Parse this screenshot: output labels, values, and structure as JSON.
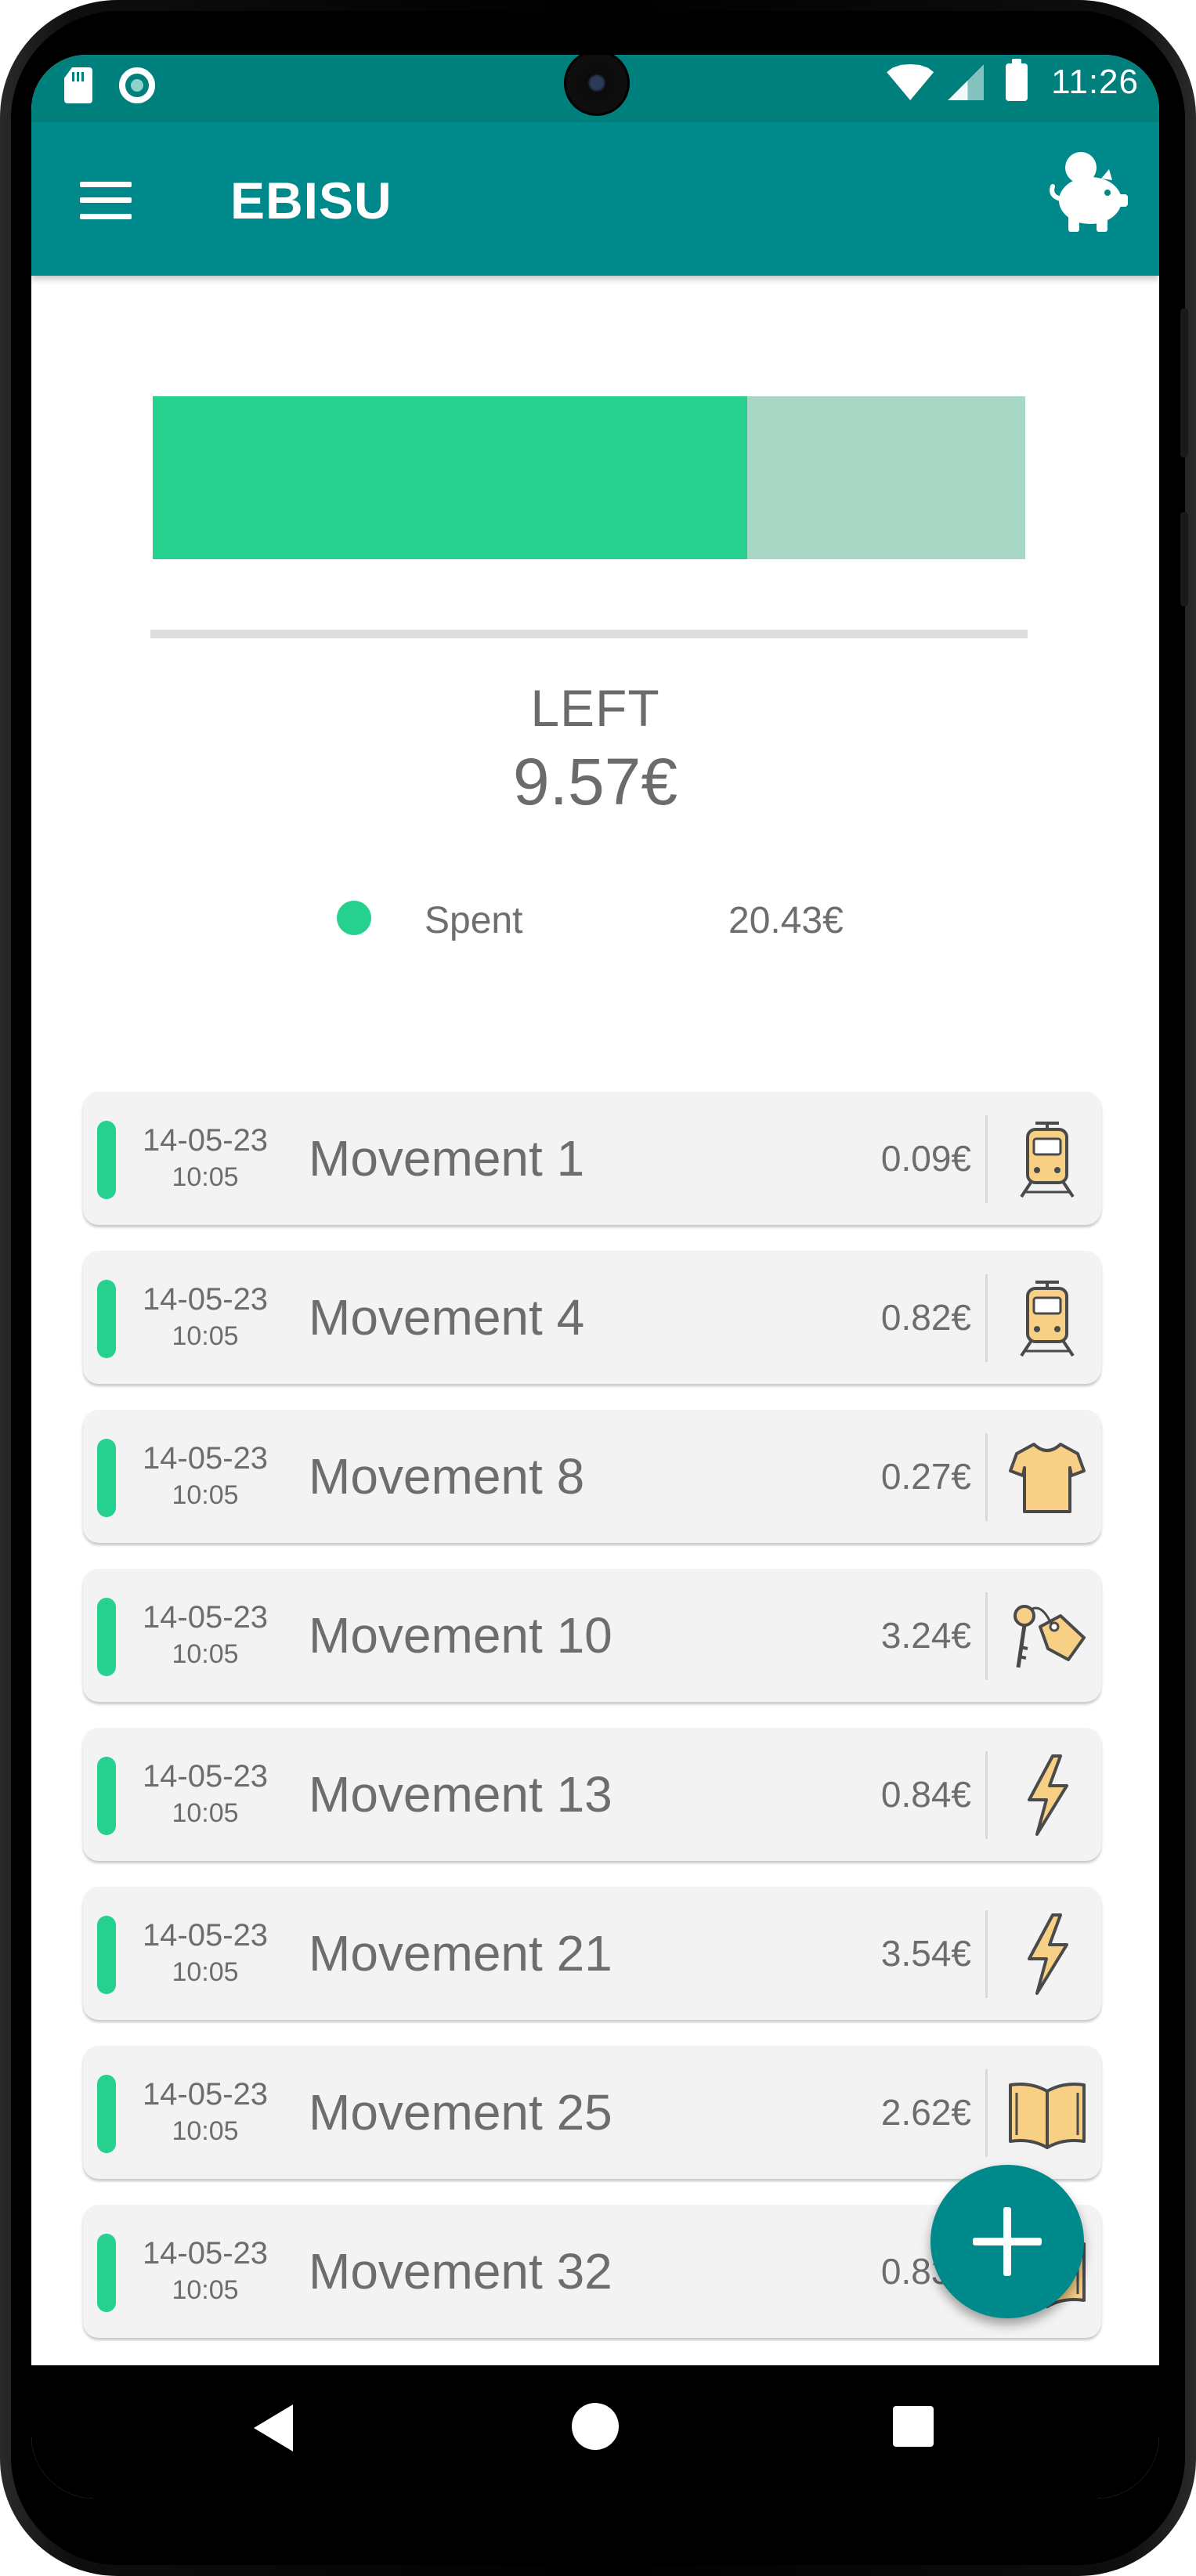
{
  "status_bar": {
    "time": "11:26",
    "icons": [
      "sd-card-icon",
      "record-icon",
      "wifi-icon",
      "signal-icon",
      "battery-icon"
    ]
  },
  "app_bar": {
    "title": "EBISU",
    "menu_icon": "hamburger-menu-icon",
    "action_icon": "piggy-bank-icon"
  },
  "summary": {
    "spent_fraction": 0.681,
    "left_label": "LEFT",
    "left_amount": "9.57€",
    "legend": {
      "label": "Spent",
      "value": "20.43€"
    }
  },
  "movements": [
    {
      "date": "14-05-23",
      "time": "10:05",
      "name": "Movement 1",
      "amount": "0.09€",
      "icon": "train-icon"
    },
    {
      "date": "14-05-23",
      "time": "10:05",
      "name": "Movement 4",
      "amount": "0.82€",
      "icon": "train-icon"
    },
    {
      "date": "14-05-23",
      "time": "10:05",
      "name": "Movement 8",
      "amount": "0.27€",
      "icon": "tshirt-icon"
    },
    {
      "date": "14-05-23",
      "time": "10:05",
      "name": "Movement 10",
      "amount": "3.24€",
      "icon": "key-tag-icon"
    },
    {
      "date": "14-05-23",
      "time": "10:05",
      "name": "Movement 13",
      "amount": "0.84€",
      "icon": "lightning-icon"
    },
    {
      "date": "14-05-23",
      "time": "10:05",
      "name": "Movement 21",
      "amount": "3.54€",
      "icon": "lightning-icon"
    },
    {
      "date": "14-05-23",
      "time": "10:05",
      "name": "Movement 25",
      "amount": "2.62€",
      "icon": "book-icon"
    },
    {
      "date": "14-05-23",
      "time": "10:05",
      "name": "Movement 32",
      "amount": "0.83€",
      "icon": "book-icon"
    }
  ],
  "fab": {
    "icon": "plus-icon"
  },
  "nav_bar": {
    "icons": [
      "nav-back-icon",
      "nav-home-icon",
      "nav-recents-icon"
    ]
  },
  "colors": {
    "primary": "#00898a",
    "status_bar": "#00807c",
    "spent": "#26d08e",
    "remaining": "#a9d7c6",
    "category_icon_fill": "#f7cf85"
  }
}
